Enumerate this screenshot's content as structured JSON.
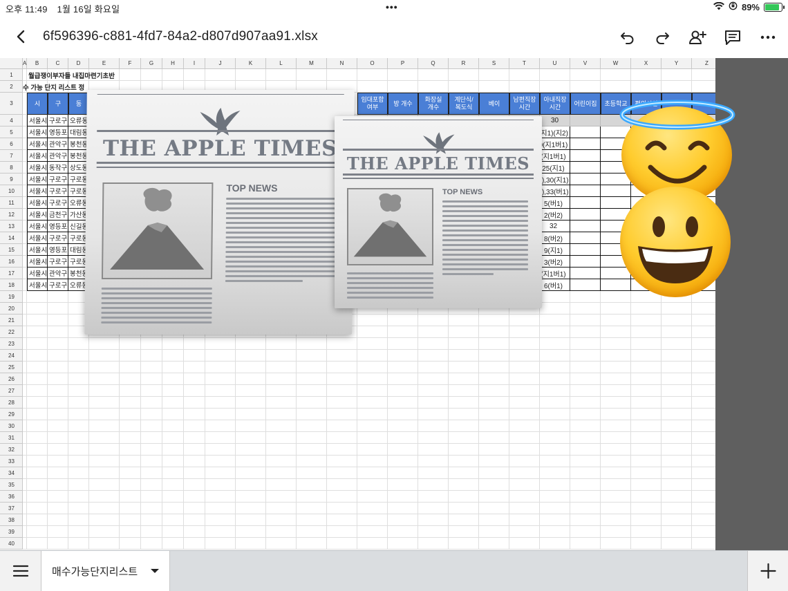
{
  "status_bar": {
    "time": "오후 11:49",
    "date": "1월 16일 화요일",
    "dots": "•••",
    "battery_text": "89%",
    "battery_level": 0.89
  },
  "toolbar": {
    "filename": "6f596396-c881-4fd7-84a2-d807d907aa91.xlsx"
  },
  "columns": [
    "A",
    "B",
    "C",
    "D",
    "E",
    "F",
    "G",
    "H",
    "I",
    "J",
    "K",
    "L",
    "M",
    "N",
    "O",
    "P",
    "Q",
    "R",
    "S",
    "T",
    "U",
    "V",
    "W",
    "X",
    "Y",
    "Z"
  ],
  "rows": [
    "1",
    "2",
    "3",
    "4",
    "5",
    "6",
    "7",
    "8",
    "9",
    "10",
    "11",
    "12",
    "13",
    "14",
    "15",
    "16",
    "17",
    "18",
    "19",
    "20",
    "21",
    "22",
    "23",
    "24",
    "25",
    "26",
    "27",
    "28",
    "29",
    "30",
    "31",
    "32",
    "33",
    "34",
    "35",
    "36",
    "37",
    "38",
    "39",
    "40"
  ],
  "sheet": {
    "title": "월급쟁이부자들 내집마련기초반",
    "subtitle": "수 가능 단지 리스트 정",
    "headers": {
      "B": "시",
      "C": "구",
      "D": "동",
      "O": "임대포함\n여부",
      "P": "방 개수",
      "Q": "화장실\n개수",
      "R": "계단식/\n복도식",
      "S": "베이",
      "T": "남편직장\n시간",
      "U": "아내직장\n시간",
      "V": "어린이집",
      "W": "초등학교",
      "X": "편의시설"
    },
    "row4_value": "30",
    "row4_partial": "직",
    "left_rows": [
      [
        "서울시",
        "구로구",
        "오류동"
      ],
      [
        "서울시",
        "영등포구",
        "대림동"
      ],
      [
        "서울시",
        "관악구",
        "봉천동"
      ],
      [
        "서울시",
        "관악구",
        "봉천동"
      ],
      [
        "서울시",
        "동작구",
        "상도동"
      ],
      [
        "서울시",
        "구로구",
        "구로동"
      ],
      [
        "서울시",
        "구로구",
        "구로동"
      ],
      [
        "서울시",
        "구로구",
        "오류동"
      ],
      [
        "서울시",
        "금천구",
        "가산동"
      ],
      [
        "서울시",
        "영등포구",
        "신길동"
      ],
      [
        "서울시",
        "구로구",
        "구로동"
      ],
      [
        "서울시",
        "영등포구",
        "대림동"
      ],
      [
        "서울시",
        "구로구",
        "구로동"
      ],
      [
        "서울시",
        "관악구",
        "봉천동"
      ],
      [
        "서울시",
        "구로구",
        "오류동"
      ]
    ],
    "u_values": [
      "(지1)(지2)",
      "0(지1버1)",
      "(지1버1)",
      "25(지1)",
      "2),30(지1)",
      "2),33(버1)",
      "5(버1)",
      "2(버2)",
      "32",
      "8(버2)",
      "9(지1)",
      "3(버2)",
      "(지1버1)",
      "6(버1)"
    ]
  },
  "overlays": {
    "newspaper_masthead": "THE APPLE TIMES",
    "newspaper_section": "TOP NEWS"
  },
  "bottom": {
    "sheet_tab": "매수가능단지리스트"
  }
}
